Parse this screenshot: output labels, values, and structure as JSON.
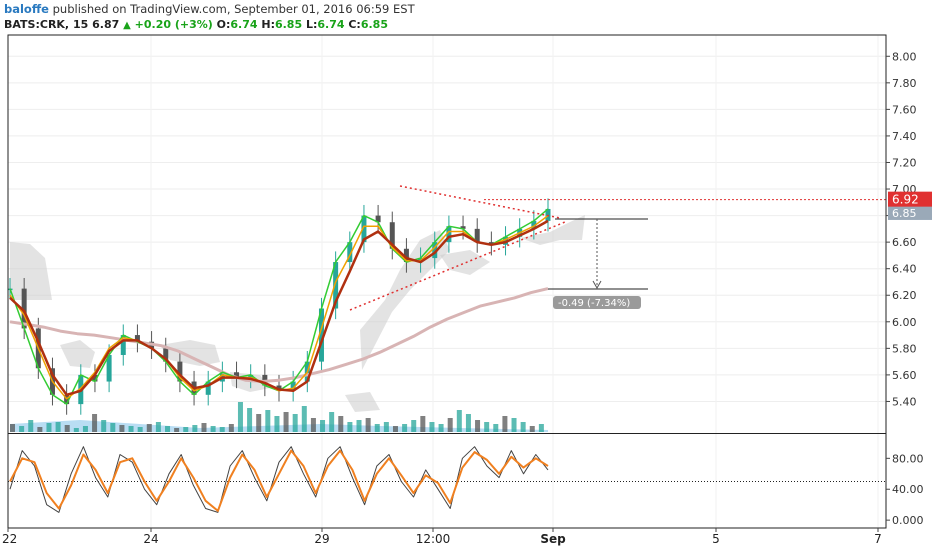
{
  "header": {
    "author": "baloffe",
    "published_text": "published on TradingView.com, September 01, 2016 06:59 EST",
    "symbol": "BATS:CRK, 15",
    "last": "6.87",
    "change": "+0.20 (+3%)",
    "o_label": "O:",
    "o_value": "6.74",
    "h_label": "H:",
    "h_value": "6.85",
    "l_label": "L:",
    "l_value": "6.74",
    "c_label": "C:",
    "c_value": "6.85"
  },
  "colors": {
    "up": "#26a69a",
    "down": "#555555",
    "ema_fast": "#33cc33",
    "ema_mid": "#f0a000",
    "ema_slow": "#b03010",
    "sma_long": "#d8b4b4",
    "cloud": "#cccccc",
    "volume_blue": "#a8d4f0",
    "resistance_line": "#e03030",
    "price_badge": "#e03030",
    "stoch_k": "#444444",
    "stoch_d": "#f08020"
  },
  "annotations": {
    "price_badge": "6.92",
    "price_label_behind": "6.85",
    "measure_label": "-0.49 (-7.34%)"
  },
  "chart_data": [
    {
      "type": "line",
      "subtype": "candlestick",
      "ylim": [
        5.2,
        8.1
      ],
      "y_ticks": [
        "8.00",
        "7.80",
        "7.60",
        "7.40",
        "7.20",
        "7.00",
        "6.80",
        "6.60",
        "6.40",
        "6.20",
        "6.00",
        "5.80",
        "5.60",
        "5.40"
      ],
      "x_ticks": [
        "22",
        "24",
        "29",
        "12:00",
        "Sep",
        "5",
        "7"
      ],
      "series": [
        {
          "values": [
            6.25,
            5.95,
            5.65,
            5.45,
            5.38,
            5.6,
            5.55,
            5.75,
            5.9,
            5.85,
            5.8,
            5.7,
            5.55,
            5.45,
            5.55,
            5.62,
            5.58,
            5.6,
            5.52,
            5.48,
            5.55,
            5.7,
            6.1,
            6.45,
            6.6,
            6.8,
            6.75,
            6.55,
            6.45,
            6.48,
            6.6,
            6.72,
            6.7,
            6.6,
            6.58,
            6.64,
            6.7,
            6.76,
            6.85
          ]
        },
        {
          "values": [
            6.2,
            6.05,
            5.8,
            5.55,
            5.42,
            5.5,
            5.62,
            5.8,
            5.88,
            5.86,
            5.8,
            5.72,
            5.58,
            5.48,
            5.52,
            5.6,
            5.58,
            5.58,
            5.54,
            5.48,
            5.5,
            5.62,
            5.95,
            6.3,
            6.5,
            6.72,
            6.72,
            6.56,
            6.46,
            6.46,
            6.56,
            6.68,
            6.68,
            6.6,
            6.58,
            6.62,
            6.67,
            6.72,
            6.8
          ]
        },
        {
          "values": [
            6.18,
            6.08,
            5.85,
            5.6,
            5.45,
            5.48,
            5.6,
            5.78,
            5.86,
            5.86,
            5.8,
            5.72,
            5.6,
            5.5,
            5.52,
            5.58,
            5.58,
            5.57,
            5.54,
            5.49,
            5.48,
            5.55,
            5.85,
            6.15,
            6.38,
            6.62,
            6.68,
            6.58,
            6.48,
            6.45,
            6.52,
            6.64,
            6.66,
            6.6,
            6.58,
            6.6,
            6.65,
            6.7,
            6.76
          ]
        },
        {
          "values": [
            6.0,
            5.98,
            5.96,
            5.93,
            5.91,
            5.9,
            5.88,
            5.86,
            5.84,
            5.82,
            5.78,
            5.72,
            5.66,
            5.6,
            5.56,
            5.55,
            5.56,
            5.58,
            5.61,
            5.64,
            5.68,
            5.72,
            5.77,
            5.83,
            5.89,
            5.96,
            6.02,
            6.07,
            6.12,
            6.15,
            6.18,
            6.22,
            6.25
          ]
        }
      ]
    },
    {
      "type": "line",
      "ylim": [
        -5,
        105
      ],
      "y_ticks": [
        "80.00",
        "40.00",
        "0.000"
      ],
      "series": [
        {
          "values": [
            40,
            90,
            70,
            20,
            10,
            60,
            95,
            55,
            30,
            85,
            75,
            40,
            20,
            60,
            85,
            45,
            15,
            10,
            70,
            90,
            55,
            25,
            75,
            95,
            60,
            30,
            80,
            95,
            55,
            20,
            70,
            85,
            50,
            30,
            65,
            40,
            15,
            80,
            95,
            70,
            55,
            90,
            60,
            85,
            65
          ]
        },
        {
          "values": [
            50,
            80,
            75,
            35,
            15,
            45,
            85,
            65,
            35,
            75,
            80,
            50,
            25,
            50,
            80,
            55,
            25,
            12,
            55,
            85,
            65,
            30,
            60,
            90,
            70,
            35,
            70,
            90,
            65,
            25,
            60,
            80,
            58,
            35,
            58,
            48,
            22,
            68,
            88,
            78,
            60,
            82,
            68,
            80,
            70
          ]
        }
      ]
    }
  ]
}
